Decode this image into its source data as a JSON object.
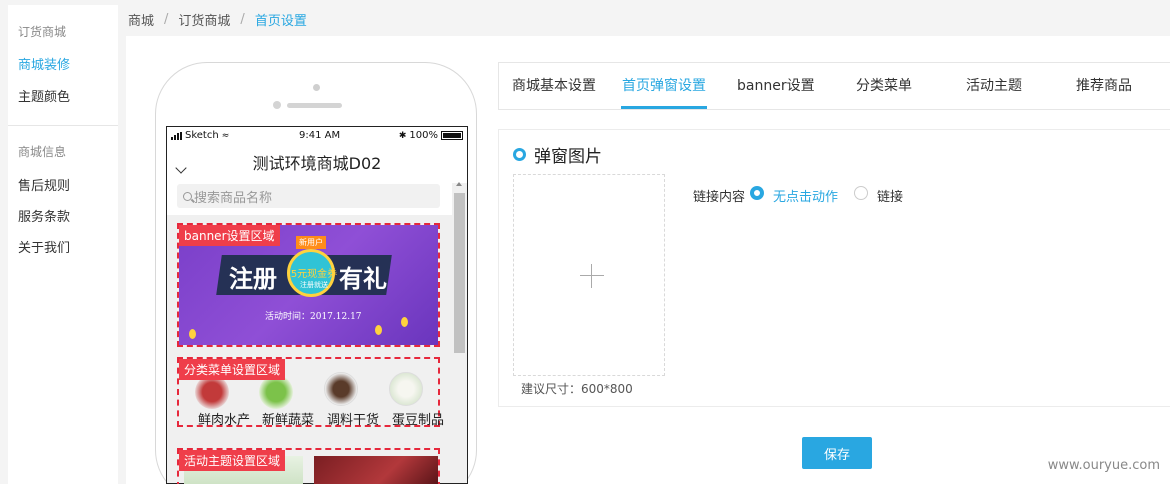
{
  "sidebar": {
    "group1_title": "订货商城",
    "group1_items": [
      {
        "label": "商城装修",
        "active": true
      },
      {
        "label": "主题颜色",
        "active": false
      }
    ],
    "group2_title": "商城信息",
    "group2_items": [
      {
        "label": "售后规则"
      },
      {
        "label": "服务条款"
      },
      {
        "label": "关于我们"
      }
    ]
  },
  "breadcrumb": [
    "商城",
    "订货商城",
    "首页设置"
  ],
  "phone": {
    "carrier": "Sketch",
    "time": "9:41 AM",
    "battery": "100%",
    "shop_title": "测试环境商城D02",
    "search_placeholder": "搜索商品名称",
    "banner_zone_label": "banner设置区域",
    "banner": {
      "badge": "新用户",
      "left_text": "注册",
      "right_text": "有礼",
      "coupon": "5元现金券",
      "coupon_sub": "注册就送",
      "date": "活动时间：2017.12.17"
    },
    "category_zone_label": "分类菜单设置区域",
    "categories": [
      "鲜肉水产",
      "新鲜蔬菜",
      "调料干货",
      "蛋豆制品"
    ],
    "activity_zone_label": "活动主题设置区域"
  },
  "tabs": [
    {
      "label": "商城基本设置",
      "active": false
    },
    {
      "label": "首页弹窗设置",
      "active": true
    },
    {
      "label": "banner设置",
      "active": false
    },
    {
      "label": "分类菜单",
      "active": false
    },
    {
      "label": "活动主题",
      "active": false
    },
    {
      "label": "推荐商品",
      "active": false
    }
  ],
  "popup": {
    "title": "弹窗图片",
    "hint": "建议尺寸：600*800",
    "link_label": "链接内容",
    "options": [
      {
        "label": "无点击动作",
        "checked": true
      },
      {
        "label": "链接",
        "checked": false
      }
    ]
  },
  "save_label": "保存",
  "watermark": "www.ouryue.com",
  "colors": {
    "accent": "#29a7e1",
    "zone_red": "#ef3e4a"
  }
}
